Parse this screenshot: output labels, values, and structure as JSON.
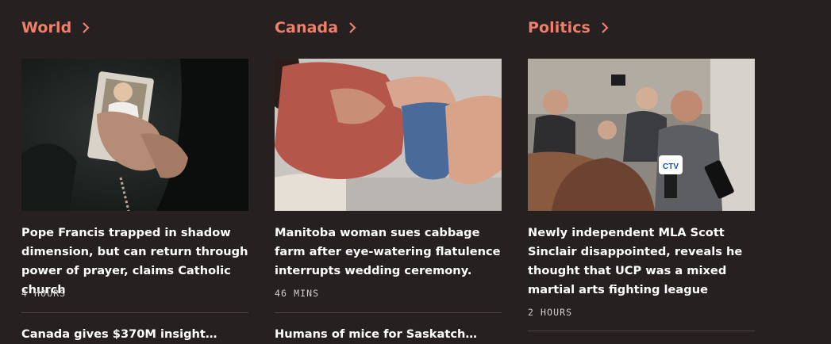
{
  "columns": [
    {
      "section": "World",
      "headline": "Pope Francis trapped in shadow dimension, but can return through power of prayer, claims Catholic church",
      "time": "4 HOURS",
      "next_headline": "Canada gives $370M insight…"
    },
    {
      "section": "Canada",
      "headline": "Manitoba woman sues cabbage farm after eye-watering flatulence interrupts wedding ceremony.",
      "time": "46 MINS",
      "next_headline": "Humans of mice for Saskatch…"
    },
    {
      "section": "Politics",
      "headline": "Newly independent MLA Scott Sinclair disappointed, reveals he thought that UCP was a mixed martial arts fighting league",
      "time": "2 HOURS",
      "next_headline": ""
    }
  ],
  "images": {
    "ctv_logo": "CTV"
  },
  "colors": {
    "background": "#262021",
    "section_accent": "#ee7f68",
    "headline": "#ffffff",
    "timestamp": "#cfcfcf",
    "divider": "#4a4244"
  },
  "icons": {
    "section_arrow": "chevron-right-icon"
  }
}
